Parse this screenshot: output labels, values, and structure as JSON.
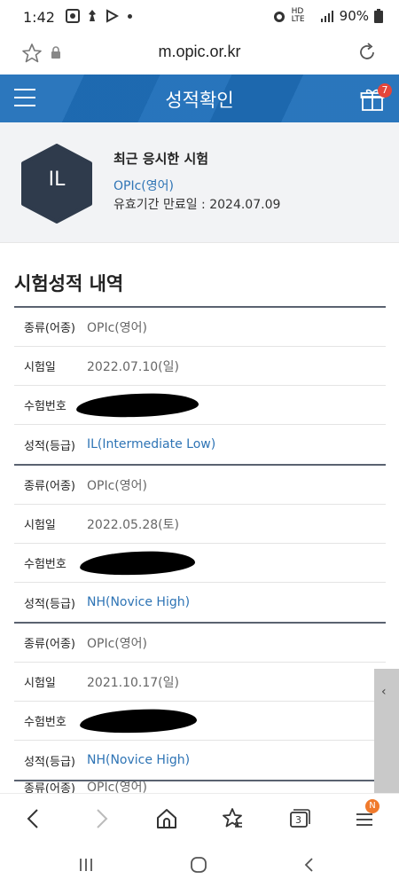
{
  "status": {
    "time": "1:42",
    "battery": "90%",
    "network": "HD LTE"
  },
  "browser": {
    "url": "m.opic.or.kr",
    "tab_count": "3",
    "menu_badge": "N"
  },
  "header": {
    "title": "성적확인",
    "gift_badge": "7"
  },
  "profile": {
    "avatar": "IL",
    "title": "최근 응시한 시험",
    "exam_type": "OPIc(영어)",
    "valid_until": "유효기간 만료일 : 2024.07.09"
  },
  "history": {
    "title": "시험성적 내역",
    "labels": {
      "type": "종류(어종)",
      "date": "시험일",
      "number": "수험번호",
      "grade": "성적(등급)"
    },
    "records": [
      {
        "type": "OPIc(영어)",
        "date": "2022.07.10(일)",
        "grade": "IL(Intermediate Low)"
      },
      {
        "type": "OPIc(영어)",
        "date": "2022.05.28(토)",
        "grade": "NH(Novice High)"
      },
      {
        "type": "OPIc(영어)",
        "date": "2021.10.17(일)",
        "grade": "NH(Novice High)"
      }
    ],
    "partial": {
      "label": "종류(어종)",
      "value": "OPIc(영어)"
    }
  },
  "colors": {
    "header": "#1f6fb9",
    "accent": "#2e74b5",
    "avatar": "#2f3b4c"
  }
}
